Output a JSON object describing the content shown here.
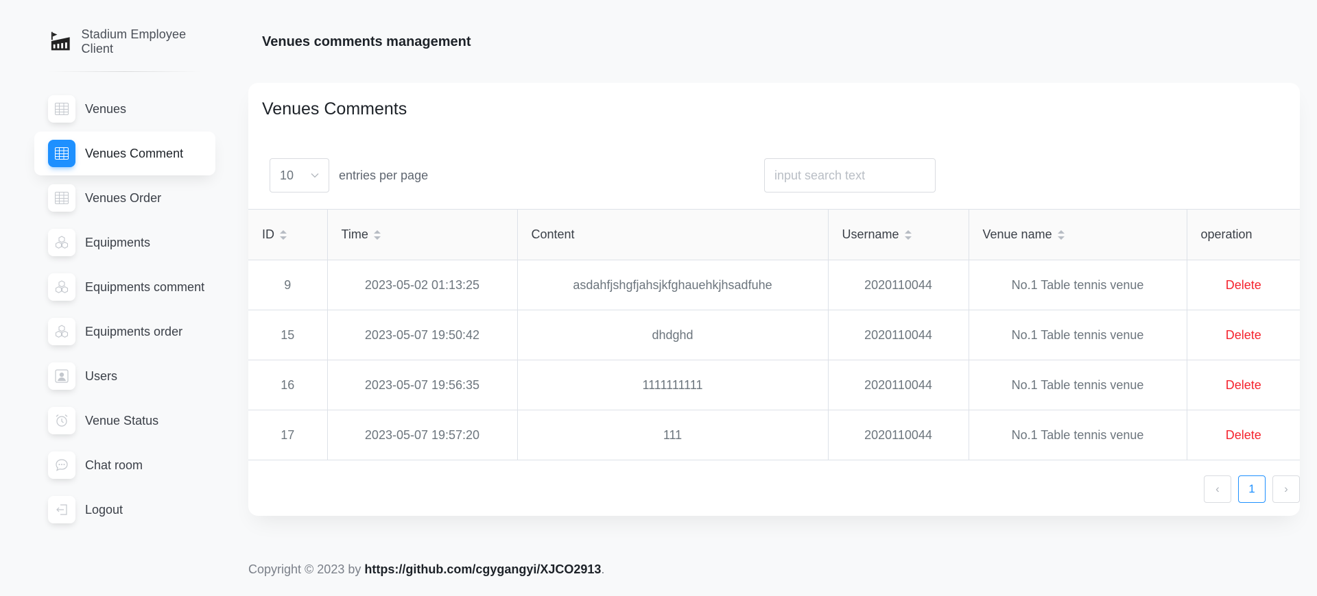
{
  "brand": {
    "name": "Stadium Employee Client",
    "icon": "stadium-logo-icon"
  },
  "sidebar": {
    "items": [
      {
        "label": "Venues",
        "icon": "table-icon",
        "active": false
      },
      {
        "label": "Venues Comment",
        "icon": "table-icon",
        "active": true
      },
      {
        "label": "Venues Order",
        "icon": "table-icon",
        "active": false
      },
      {
        "label": "Equipments",
        "icon": "cubes-icon",
        "active": false
      },
      {
        "label": "Equipments comment",
        "icon": "cubes-icon",
        "active": false
      },
      {
        "label": "Equipments order",
        "icon": "cubes-icon",
        "active": false
      },
      {
        "label": "Users",
        "icon": "user-card-icon",
        "active": false
      },
      {
        "label": "Venue Status",
        "icon": "alarm-clock-icon",
        "active": false
      },
      {
        "label": "Chat room",
        "icon": "chat-bubble-icon",
        "active": false
      },
      {
        "label": "Logout",
        "icon": "logout-icon",
        "active": false
      }
    ]
  },
  "header": {
    "title": "Venues comments management"
  },
  "card": {
    "title": "Venues Comments",
    "entries": {
      "value": "10",
      "label": "entries per page"
    },
    "search": {
      "placeholder": "input search text"
    },
    "columns": [
      "ID",
      "Time",
      "Content",
      "Username",
      "Venue name",
      "operation"
    ],
    "rows": [
      {
        "id": "9",
        "time": "2023-05-02 01:13:25",
        "content": "asdahfjshgfjahsjkfghauehkjhsadfuhe",
        "username": "2020110044",
        "venue": "No.1 Table tennis venue",
        "op": "Delete"
      },
      {
        "id": "15",
        "time": "2023-05-07 19:50:42",
        "content": "dhdghd",
        "username": "2020110044",
        "venue": "No.1 Table tennis venue",
        "op": "Delete"
      },
      {
        "id": "16",
        "time": "2023-05-07 19:56:35",
        "content": "1111111111",
        "username": "2020110044",
        "venue": "No.1 Table tennis venue",
        "op": "Delete"
      },
      {
        "id": "17",
        "time": "2023-05-07 19:57:20",
        "content": "111",
        "username": "2020110044",
        "venue": "No.1 Table tennis venue",
        "op": "Delete"
      }
    ],
    "pagination": {
      "prev": "‹",
      "current": "1",
      "next": "›"
    }
  },
  "footer": {
    "prefix": "Copyright © 2023 by ",
    "link": "https://github.com/cgygangyi/XJCO2913",
    "suffix": "."
  },
  "colors": {
    "accent": "#1e90ff",
    "danger": "#f5222d"
  }
}
